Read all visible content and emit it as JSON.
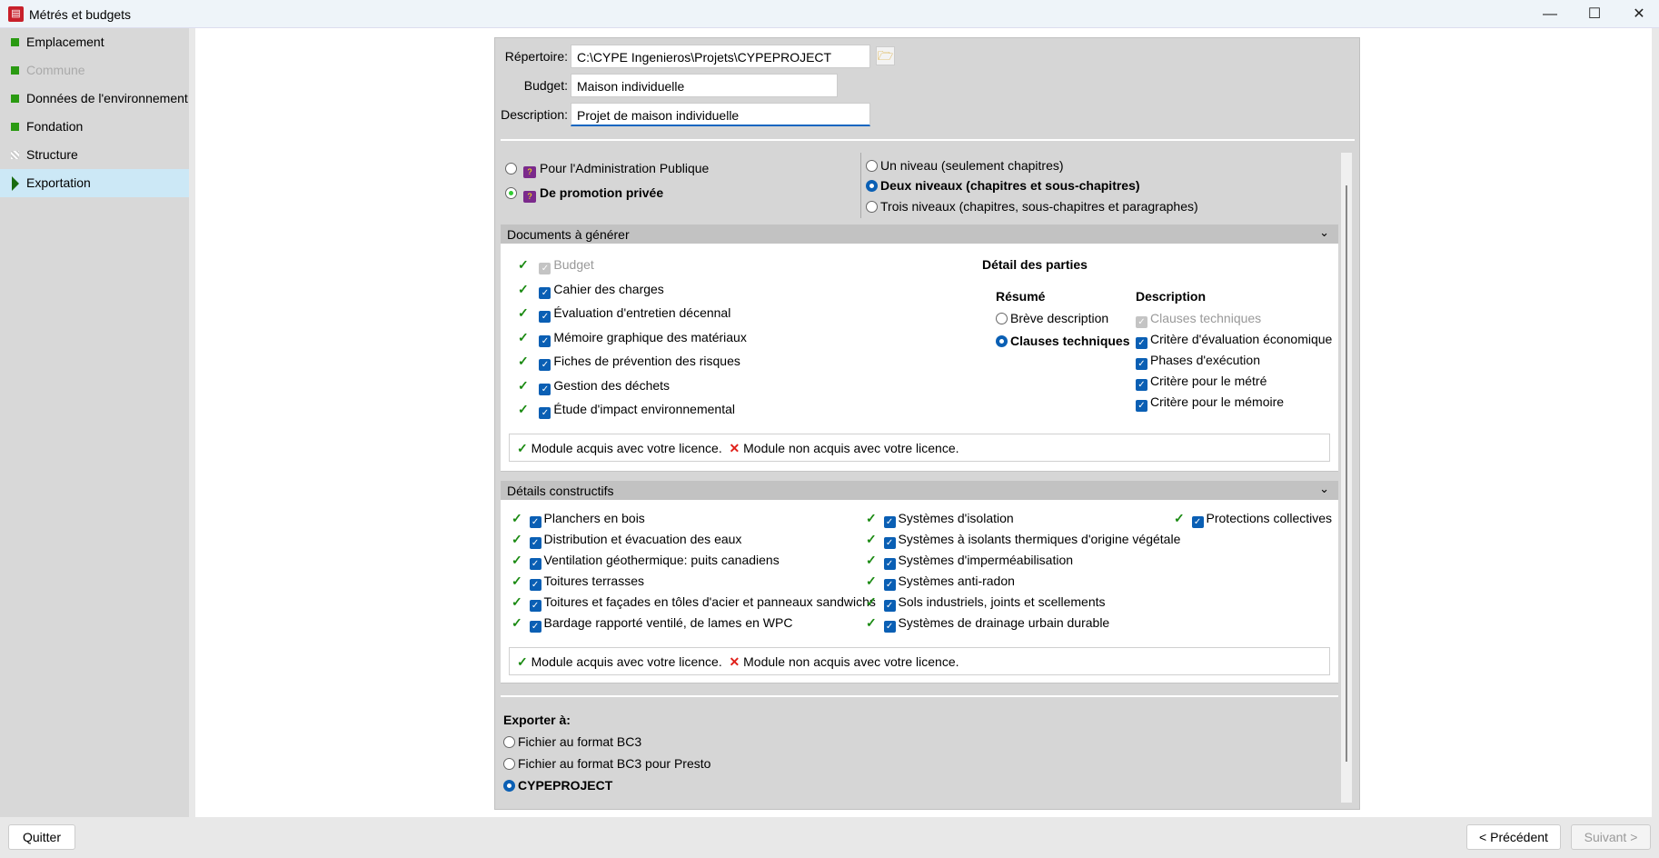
{
  "window": {
    "title": "Métrés et budgets",
    "minimize": "—",
    "maximize": "☐",
    "close": "✕"
  },
  "sidebar": {
    "items": [
      {
        "label": "Emplacement",
        "status": "done"
      },
      {
        "label": "Commune",
        "status": "disabled"
      },
      {
        "label": "Données de l'environnement",
        "status": "done"
      },
      {
        "label": "Fondation",
        "status": "done"
      },
      {
        "label": "Structure",
        "status": "empty"
      },
      {
        "label": "Exportation",
        "status": "active"
      }
    ]
  },
  "form": {
    "repertoire_label": "Répertoire:",
    "repertoire_value": "C:\\CYPE Ingenieros\\Projets\\CYPEPROJECT",
    "budget_label": "Budget:",
    "budget_value": "Maison individuelle",
    "description_label": "Description:",
    "description_value": "Projet de maison individuelle"
  },
  "type": {
    "options": [
      "Pour l'Administration Publique",
      "De promotion privée"
    ],
    "selected": 1
  },
  "levels": {
    "options": [
      "Un niveau (seulement chapitres)",
      "Deux niveaux (chapitres et sous-chapitres)",
      "Trois niveaux (chapitres, sous-chapitres et paragraphes)"
    ],
    "selected": 1
  },
  "documents": {
    "title": "Documents à générer",
    "items": [
      "Budget",
      "Cahier des charges",
      "Évaluation d'entretien décennal",
      "Mémoire graphique des matériaux",
      "Fiches de prévention des risques",
      "Gestion des déchets",
      "Étude d'impact environnemental"
    ],
    "detail_title": "Détail des parties",
    "resume_title": "Résumé",
    "resume_options": [
      "Brève description",
      "Clauses techniques"
    ],
    "resume_selected": 1,
    "description_title": "Description",
    "description_items": [
      "Clauses techniques",
      "Critère d'évaluation économique",
      "Phases d'exécution",
      "Critère pour le métré",
      "Critère pour le mémoire"
    ]
  },
  "license": {
    "acquired": "Module acquis avec votre licence.",
    "not_acquired": "Module non acquis avec votre licence."
  },
  "details": {
    "title": "Détails constructifs",
    "col1": [
      "Planchers en bois",
      "Distribution et évacuation des eaux",
      "Ventilation géothermique: puits canadiens",
      "Toitures terrasses",
      "Toitures et façades en tôles d'acier et panneaux sandwichs",
      "Bardage rapporté ventilé, de lames en WPC"
    ],
    "col2": [
      "Systèmes d'isolation",
      "Systèmes à isolants thermiques d'origine végétale",
      "Systèmes d'imperméabilisation",
      "Systèmes anti-radon",
      "Sols industriels, joints et scellements",
      "Systèmes de drainage urbain durable"
    ],
    "col3": [
      "Protections collectives"
    ]
  },
  "export": {
    "title": "Exporter à:",
    "options": [
      "Fichier au format BC3",
      "Fichier au format BC3 pour Presto",
      "CYPEPROJECT"
    ],
    "selected": 2
  },
  "buttons": {
    "quit": "Quitter",
    "previous": "< Précédent",
    "next": "Suivant >"
  },
  "colors": {
    "accent": "#0a5fb4",
    "ok": "#1a8a12",
    "error": "#e0201a",
    "active_item": "#cce8f6"
  }
}
